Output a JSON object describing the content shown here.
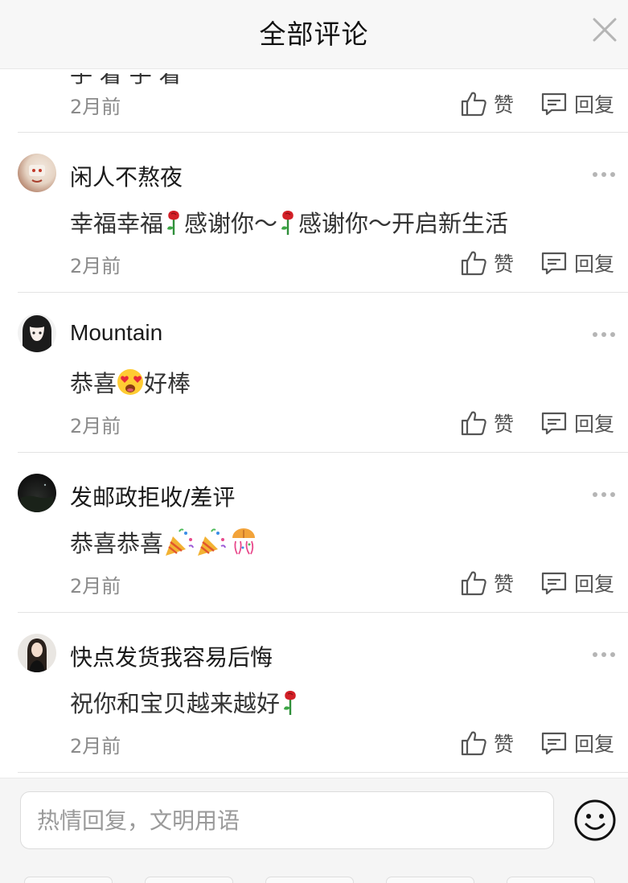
{
  "header": {
    "title": "全部评论"
  },
  "first_comment_partial": {
    "cut_text": "手 着 手 着",
    "time": "2月前",
    "like_label": "赞",
    "reply_label": "回复"
  },
  "comments": [
    {
      "username": "闲人不熬夜",
      "content_parts": [
        "幸福幸福",
        "感谢你～",
        "感谢你～开启新生活"
      ],
      "emojis": [
        "rose",
        "rose"
      ],
      "time": "2月前",
      "like_label": "赞",
      "reply_label": "回复"
    },
    {
      "username": "Mountain",
      "content_parts": [
        "恭喜",
        "好棒"
      ],
      "emojis": [
        "heart-eyes"
      ],
      "time": "2月前",
      "like_label": "赞",
      "reply_label": "回复"
    },
    {
      "username": "发邮政拒收/差评",
      "content_parts": [
        "恭喜恭喜"
      ],
      "emojis": [
        "party-popper",
        "party-popper",
        "confetti-ball"
      ],
      "time": "2月前",
      "like_label": "赞",
      "reply_label": "回复"
    },
    {
      "username": "快点发货我容易后悔",
      "content_parts": [
        "祝你和宝贝越来越好"
      ],
      "emojis": [
        "rose"
      ],
      "time": "2月前",
      "like_label": "赞",
      "reply_label": "回复"
    }
  ],
  "footer": {
    "reply_placeholder": "热情回复，文明用语"
  },
  "icons": {
    "close": "close-icon",
    "more": "more-dots-icon",
    "like": "thumbs-up-icon",
    "reply": "comment-icon",
    "emoji": "smiley-icon"
  },
  "colors": {
    "header_bg": "#f7f7f7",
    "text_primary": "#1a1a1a",
    "text_secondary": "#8a8a8a",
    "divider": "#e3e3e3"
  }
}
